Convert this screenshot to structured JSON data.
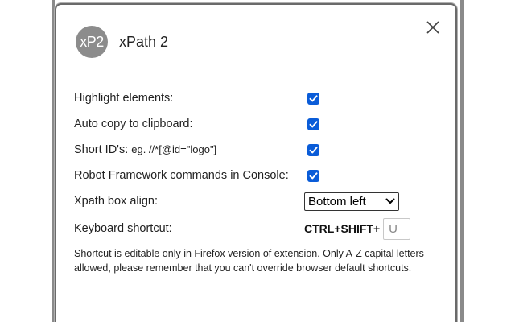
{
  "app": {
    "logo_text": "xP2",
    "title": "xPath 2"
  },
  "settings": [
    {
      "label": "Highlight elements:",
      "checked": true
    },
    {
      "label": "Auto copy to clipboard:",
      "checked": true
    },
    {
      "label": "Short ID's:",
      "hint": "eg. //*[@id=\"logo\"]",
      "checked": true
    },
    {
      "label": "Robot Framework commands in Console:",
      "checked": true
    }
  ],
  "align": {
    "label": "Xpath box align:",
    "value": "Bottom left"
  },
  "shortcut": {
    "label": "Keyboard shortcut:",
    "prefix": "CTRL+SHIFT+",
    "key": "U"
  },
  "note": "Shortcut is editable only in Firefox version of extension. Only A-Z capital letters allowed, please remember that you can't override browser default shortcuts.",
  "colors": {
    "checkbox": "#0a5cd8",
    "logo_bg": "#8c8c8c"
  },
  "icons": {
    "close": "close-icon",
    "check": "check-icon",
    "dropdown": "chevron-down-icon"
  }
}
